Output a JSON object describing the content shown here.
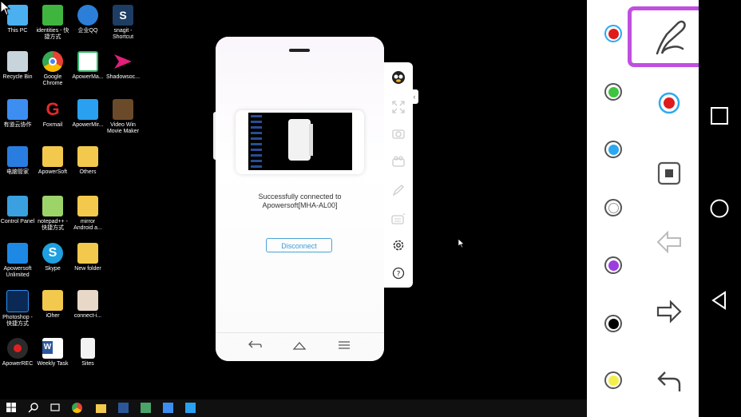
{
  "desktop": {
    "icons": [
      {
        "label": "This PC"
      },
      {
        "label": "identities - 快\n捷方式"
      },
      {
        "label": "企业QQ"
      },
      {
        "label": "snagit -\nShortcut"
      },
      {
        "label": "Recycle Bin"
      },
      {
        "label": "Google\nChrome"
      },
      {
        "label": "ApowerMa..."
      },
      {
        "label": "Shadowsoc..."
      },
      {
        "label": "有道云协作"
      },
      {
        "label": "Foxmail"
      },
      {
        "label": "ApowerMir..."
      },
      {
        "label": "Video Win\nMovie Maker"
      },
      {
        "label": "电脑管家"
      },
      {
        "label": "ApowerSoft"
      },
      {
        "label": "Others"
      },
      {
        "label": "Control Panel"
      },
      {
        "label": "notepad++ -\n快捷方式"
      },
      {
        "label": "mirror\nAndroid a..."
      },
      {
        "label": "Apowersoft\nUnlimited"
      },
      {
        "label": "Skype"
      },
      {
        "label": "New folder"
      },
      {
        "label": "Photoshop -\n快捷方式"
      },
      {
        "label": "iOher"
      },
      {
        "label": "connect-i..."
      },
      {
        "label": "ApowerREC"
      },
      {
        "label": "Weekly Task"
      },
      {
        "label": "Sites"
      }
    ]
  },
  "phone": {
    "status_line1": "Successfully connected to",
    "status_line2": "Apowersoft[MHA-AL00]",
    "disconnect_label": "Disconnect"
  },
  "colors": {
    "accent_purple": "#c04fe0",
    "swatches": [
      "#e01b1b",
      "#3ec43e",
      "#2aa9f0",
      "#ffffff",
      "#9b3de0",
      "#000000",
      "#f3ef4a"
    ]
  },
  "tools": {
    "icons": [
      "avatar-icon",
      "fullscreen-icon",
      "screenshot-icon",
      "record-icon",
      "pen-icon",
      "keyboard-icon",
      "settings-icon",
      "help-icon"
    ],
    "right_icons": [
      "pen-icon",
      "current-color-icon",
      "stop-icon",
      "arrow-left-icon",
      "arrow-right-icon",
      "undo-icon"
    ]
  }
}
